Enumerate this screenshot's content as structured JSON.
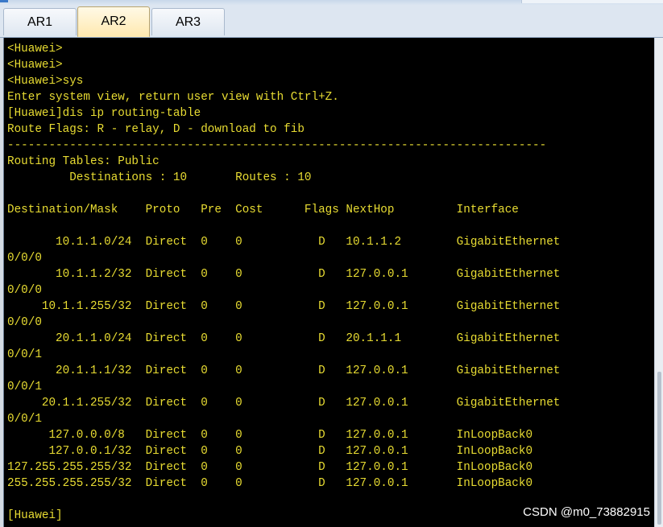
{
  "tabs": [
    {
      "label": "AR1",
      "active": false
    },
    {
      "label": "AR2",
      "active": true
    },
    {
      "label": "AR3",
      "active": false
    }
  ],
  "terminal": {
    "text_color": "#e8dc32",
    "background": "#000000",
    "lines": [
      "<Huawei>",
      "<Huawei>",
      "<Huawei>sys",
      "Enter system view, return user view with Ctrl+Z.",
      "[Huawei]dis ip routing-table",
      "Route Flags: R - relay, D - download to fib",
      "------------------------------------------------------------------------------",
      "Routing Tables: Public",
      "         Destinations : 10       Routes : 10",
      "",
      "Destination/Mask    Proto   Pre  Cost      Flags NextHop         Interface",
      "",
      "       10.1.1.0/24  Direct  0    0           D   10.1.1.2        GigabitEthernet",
      "0/0/0",
      "       10.1.1.2/32  Direct  0    0           D   127.0.0.1       GigabitEthernet",
      "0/0/0",
      "     10.1.1.255/32  Direct  0    0           D   127.0.0.1       GigabitEthernet",
      "0/0/0",
      "       20.1.1.0/24  Direct  0    0           D   20.1.1.1        GigabitEthernet",
      "0/0/1",
      "       20.1.1.1/32  Direct  0    0           D   127.0.0.1       GigabitEthernet",
      "0/0/1",
      "     20.1.1.255/32  Direct  0    0           D   127.0.0.1       GigabitEthernet",
      "0/0/1",
      "      127.0.0.0/8   Direct  0    0           D   127.0.0.1       InLoopBack0",
      "      127.0.0.1/32  Direct  0    0           D   127.0.0.1       InLoopBack0",
      "127.255.255.255/32  Direct  0    0           D   127.0.0.1       InLoopBack0",
      "255.255.255.255/32  Direct  0    0           D   127.0.0.1       InLoopBack0",
      "",
      "[Huawei]"
    ]
  },
  "watermark": "CSDN @m0_73882915"
}
